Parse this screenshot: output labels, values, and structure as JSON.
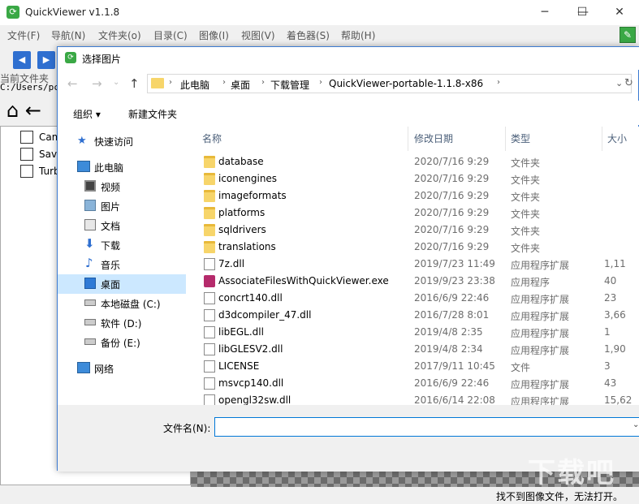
{
  "app": {
    "title": "QuickViewer v1.1.8",
    "icon": "app-icon",
    "window_controls": [
      "minimize-icon",
      "maximize-icon",
      "close-icon"
    ],
    "menu": [
      "文件(F)",
      "导航(N)",
      "文件夹(o)",
      "目录(C)",
      "图像(I)",
      "视图(V)",
      "着色器(S)",
      "帮助(H)"
    ],
    "current_folder_label": "当前文件夹",
    "current_folder_path": "C:/Users/pc/",
    "checkboxes": [
      {
        "label": "Cam",
        "checked": false
      },
      {
        "label": "Save",
        "checked": false
      },
      {
        "label": "Turb",
        "checked": false
      }
    ],
    "status_text": "找不到图像文件，无法打开。"
  },
  "dialog": {
    "title": "选择图片",
    "breadcrumbs": [
      "此电脑",
      "桌面",
      "下载管理",
      "QuickViewer-portable-1.1.8-x86"
    ],
    "organize_label": "组织 ▾",
    "new_folder_label": "新建文件夹",
    "nav_items": [
      {
        "label": "快速访问",
        "icon": "star-icon",
        "selected": false
      },
      {
        "label": "此电脑",
        "icon": "computer-icon",
        "selected": false
      },
      {
        "label": "视频",
        "icon": "video-icon",
        "selected": false
      },
      {
        "label": "图片",
        "icon": "picture-icon",
        "selected": false
      },
      {
        "label": "文档",
        "icon": "document-icon",
        "selected": false
      },
      {
        "label": "下载",
        "icon": "download-icon",
        "selected": false
      },
      {
        "label": "音乐",
        "icon": "music-icon",
        "selected": false
      },
      {
        "label": "桌面",
        "icon": "desktop-icon",
        "selected": true
      },
      {
        "label": "本地磁盘 (C:)",
        "icon": "drive-icon",
        "selected": false
      },
      {
        "label": "软件 (D:)",
        "icon": "drive-icon",
        "selected": false
      },
      {
        "label": "备份 (E:)",
        "icon": "drive-icon",
        "selected": false
      },
      {
        "label": "网络",
        "icon": "network-icon",
        "selected": false
      }
    ],
    "columns": [
      "名称",
      "修改日期",
      "类型",
      "大小"
    ],
    "files": [
      {
        "name": "database",
        "date": "2020/7/16 9:29",
        "type": "文件夹",
        "size": "",
        "kind": "folder"
      },
      {
        "name": "iconengines",
        "date": "2020/7/16 9:29",
        "type": "文件夹",
        "size": "",
        "kind": "folder"
      },
      {
        "name": "imageformats",
        "date": "2020/7/16 9:29",
        "type": "文件夹",
        "size": "",
        "kind": "folder"
      },
      {
        "name": "platforms",
        "date": "2020/7/16 9:29",
        "type": "文件夹",
        "size": "",
        "kind": "folder"
      },
      {
        "name": "sqldrivers",
        "date": "2020/7/16 9:29",
        "type": "文件夹",
        "size": "",
        "kind": "folder"
      },
      {
        "name": "translations",
        "date": "2020/7/16 9:29",
        "type": "文件夹",
        "size": "",
        "kind": "folder"
      },
      {
        "name": "7z.dll",
        "date": "2019/7/23 11:49",
        "type": "应用程序扩展",
        "size": "1,11",
        "kind": "file"
      },
      {
        "name": "AssociateFilesWithQuickViewer.exe",
        "date": "2019/9/23 23:38",
        "type": "应用程序",
        "size": "40",
        "kind": "exe"
      },
      {
        "name": "concrt140.dll",
        "date": "2016/6/9 22:46",
        "type": "应用程序扩展",
        "size": "23",
        "kind": "file"
      },
      {
        "name": "d3dcompiler_47.dll",
        "date": "2016/7/28 8:01",
        "type": "应用程序扩展",
        "size": "3,66",
        "kind": "file"
      },
      {
        "name": "libEGL.dll",
        "date": "2019/4/8 2:35",
        "type": "应用程序扩展",
        "size": "1",
        "kind": "file"
      },
      {
        "name": "libGLESV2.dll",
        "date": "2019/4/8 2:34",
        "type": "应用程序扩展",
        "size": "1,90",
        "kind": "file"
      },
      {
        "name": "LICENSE",
        "date": "2017/9/11 10:45",
        "type": "文件",
        "size": "3",
        "kind": "file"
      },
      {
        "name": "msvcp140.dll",
        "date": "2016/6/9 22:46",
        "type": "应用程序扩展",
        "size": "43",
        "kind": "file"
      },
      {
        "name": "opengl32sw.dll",
        "date": "2016/6/14 22:08",
        "type": "应用程序扩展",
        "size": "15,62",
        "kind": "file"
      }
    ],
    "filename_label": "文件名(N):",
    "filename_value": ""
  },
  "colors": {
    "accent": "#0078d7",
    "selected_bg": "#cce8ff",
    "app_green": "#3aa845",
    "nav_blue": "#2f6fd0"
  }
}
